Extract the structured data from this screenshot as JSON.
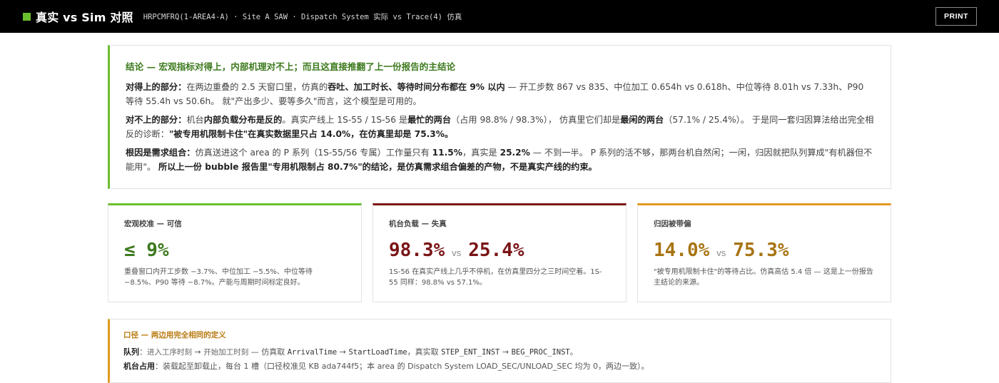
{
  "header": {
    "title": "真实 vs Sim 对照",
    "breadcrumb": "HRPCMFRQ(1-AREA4-A) · Site A SAW · Dispatch System 实际 vs Trace(4) 仿真",
    "print_label": "PRINT",
    "accent_color": "#6abf2e"
  },
  "conclusion": {
    "heading": "结论 — 宏观指标对得上，内部机理对不上；而且这直接推翻了上一份报告的主结论",
    "p1": {
      "lead": "对得上的部分：",
      "t1": "在两边重叠的 2.5 天窗口里，仿真的",
      "b1": "吞吐、加工时长、等待时间分布都在 9% 以内",
      "t2": " — 开工步数 867 vs 835、中位加工 0.654h vs 0.618h、中位等待 8.01h vs 7.33h、P90 等待 55.4h vs 50.6h。 就\"产出多少、要等多久\"而言，这个模型是可用的。"
    },
    "p2": {
      "lead": "对不上的部分：",
      "t1": "机台",
      "b1": "内部负载分布是反的",
      "t2": "。真实产线上 1S-55 / 1S-56 是",
      "b2": "最忙的两台",
      "t3": "（占用 98.8% / 98.3%）， 仿真里它们却是",
      "b3": "最闲的两台",
      "t4": "（57.1% / 25.4%）。 于是同一套归因算法给出完全相反的诊断：",
      "b4": "\"被专用机限制卡住\"在真实数据里只占 14.0%，在仿真里却是 75.3%。"
    },
    "p3": {
      "lead": "根因是需求组合：",
      "t1": "仿真送进这个 area 的 P 系列（1S-55/56 专属）工作量只有 ",
      "b1": "11.5%",
      "t2": "，真实是 ",
      "b2": "25.2%",
      "t3": " — 不到一半。 P 系列的活不够，那两台机自然闲；一闲，归因就把队列算成\"有机器但不能用\"。 ",
      "b3": "所以上一份 bubble 报告里\"专用机限制占 80.7%\"的结论，是仿真需求组合偏差的产物，不是真实产线的约束。"
    }
  },
  "cards": [
    {
      "label": "宏观校准 — 可信",
      "value": "≤ 9%",
      "note": "重叠窗口内开工步数 −3.7%、中位加工 −5.5%、中位等待 −8.5%、P90 等待 −8.7%。产能与周期时间标定良好。",
      "color": "#3d7a1e"
    },
    {
      "label": "机台负载 — 失真",
      "value_a": "98.3%",
      "vs": "vs",
      "value_b": "25.4%",
      "note": "1S-56 在真实产线上几乎不停机，在仿真里四分之三时间空着。1S-55 同样：98.8% vs 57.1%。",
      "color": "#7a1416"
    },
    {
      "label": "归因被带偏",
      "value_a": "14.0%",
      "vs": "vs",
      "value_b": "75.3%",
      "note": "\"被专用机限制卡住\"的等待占比。仿真高估 5.4 倍 — 这是上一份报告主结论的来源。",
      "color": "#a87412"
    }
  ],
  "definitions": {
    "heading": "口径 — 两边用完全相同的定义",
    "queue": {
      "lead": "队列",
      "sep": "：",
      "m1": "进入工序时刻",
      "arrow1": " → ",
      "m2": "开始加工时刻",
      "t1": " — 仿真取 ",
      "c1": "ArrivalTime",
      "arrow2": " → ",
      "c2": "StartLoadTime",
      "t2": "，真实取 ",
      "c3": "STEP_ENT_INST",
      "arrow3": " → ",
      "c4": "BEG_PROC_INST",
      "t3": "。"
    },
    "machine": {
      "lead": "机台占用",
      "sep": "：",
      "text": "装载起至卸载止，每台 1 槽（口径校准见 KB ada744f5；本 area 的 Dispatch System LOAD_SEC/UNLOAD_SEC 均为 0，两边一致）。"
    },
    "accent_color": "#e09a1f"
  }
}
